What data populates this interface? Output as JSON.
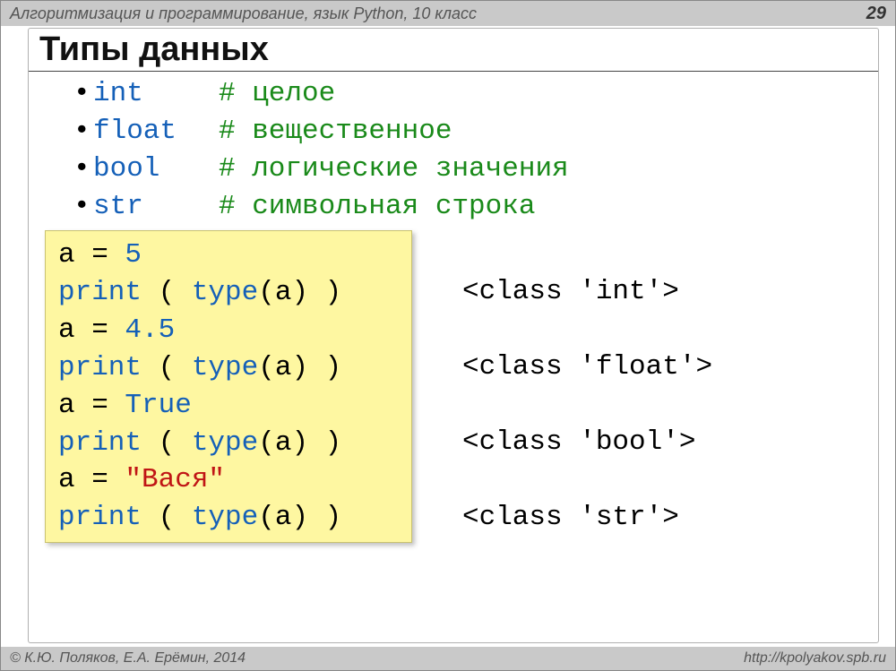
{
  "header": {
    "title": "Алгоритмизация и программирование, язык Python, 10 класс",
    "page": "29"
  },
  "footer": {
    "left": "© К.Ю. Поляков, Е.А. Ерёмин, 2014",
    "right": "http://kpolyakov.spb.ru"
  },
  "title": "Типы данных",
  "types": [
    {
      "kw": "int",
      "comment": "# целое"
    },
    {
      "kw": "float",
      "comment": "# вещественное"
    },
    {
      "kw": "bool",
      "comment": "# логические значения"
    },
    {
      "kw": "str",
      "comment": "# символьная строка"
    }
  ],
  "code": {
    "l1_a": "a",
    "l1_eq": " = ",
    "l1_v": "5",
    "l2_p": "print",
    "l2_rest": " ( ",
    "l2_t": "type",
    "l2_args": "(a) )",
    "l3_a": "a",
    "l3_eq": " = ",
    "l3_v": "4.5",
    "l5_a": "a",
    "l5_eq": " = ",
    "l5_v": "True",
    "l7_a": "a",
    "l7_eq": " = ",
    "l7_v": "\"Вася\""
  },
  "output": {
    "o1": "<class 'int'>",
    "o2": "<class 'float'>",
    "o3": "<class 'bool'>",
    "o4": "<class 'str'>"
  }
}
